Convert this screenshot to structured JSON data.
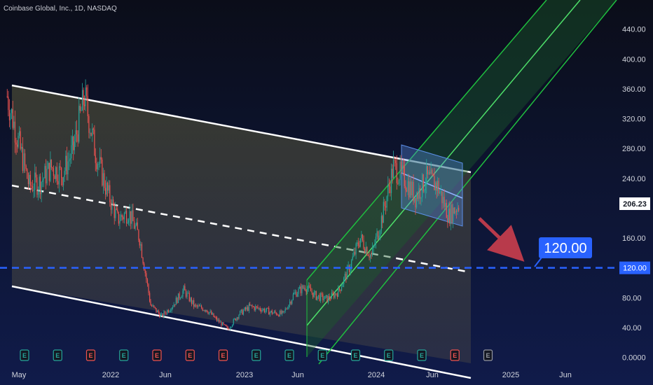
{
  "header": {
    "title": "Coinbase Global, Inc., 1D, NASDAQ"
  },
  "chart_data": {
    "type": "candlestick",
    "title": "Coinbase Global, Inc., 1D, NASDAQ",
    "y_ticks": [
      "440.00",
      "400.00",
      "360.00",
      "320.00",
      "280.00",
      "240.00",
      "160.00",
      "80.00",
      "40.00",
      "0.0000"
    ],
    "x_ticks": [
      "May",
      "2022",
      "Jun",
      "2023",
      "Jun",
      "2024",
      "Jun",
      "2025",
      "Jun"
    ],
    "ylim": [
      0,
      480
    ],
    "last_price": "206.23",
    "target_price": "120.00",
    "target_line_label": "120.00",
    "price_path": [
      {
        "x": "2021-04",
        "y": 350
      },
      {
        "x": "2021-05",
        "y": 290
      },
      {
        "x": "2021-06",
        "y": 230
      },
      {
        "x": "2021-07",
        "y": 235
      },
      {
        "x": "2021-08",
        "y": 255
      },
      {
        "x": "2021-09",
        "y": 245
      },
      {
        "x": "2021-10",
        "y": 280
      },
      {
        "x": "2021-11",
        "y": 350
      },
      {
        "x": "2021-12",
        "y": 275
      },
      {
        "x": "2022-01",
        "y": 225
      },
      {
        "x": "2022-02",
        "y": 185
      },
      {
        "x": "2022-03",
        "y": 195
      },
      {
        "x": "2022-04",
        "y": 160
      },
      {
        "x": "2022-05",
        "y": 70
      },
      {
        "x": "2022-06",
        "y": 55
      },
      {
        "x": "2022-07",
        "y": 70
      },
      {
        "x": "2022-08",
        "y": 90
      },
      {
        "x": "2022-09",
        "y": 68
      },
      {
        "x": "2022-10",
        "y": 65
      },
      {
        "x": "2022-11",
        "y": 50
      },
      {
        "x": "2022-12",
        "y": 38
      },
      {
        "x": "2023-01",
        "y": 58
      },
      {
        "x": "2023-02",
        "y": 68
      },
      {
        "x": "2023-03",
        "y": 65
      },
      {
        "x": "2023-04",
        "y": 60
      },
      {
        "x": "2023-05",
        "y": 58
      },
      {
        "x": "2023-06",
        "y": 85
      },
      {
        "x": "2023-07",
        "y": 95
      },
      {
        "x": "2023-08",
        "y": 82
      },
      {
        "x": "2023-09",
        "y": 78
      },
      {
        "x": "2023-10",
        "y": 88
      },
      {
        "x": "2023-11",
        "y": 120
      },
      {
        "x": "2023-12",
        "y": 160
      },
      {
        "x": "2024-01",
        "y": 135
      },
      {
        "x": "2024-02",
        "y": 190
      },
      {
        "x": "2024-03",
        "y": 255
      },
      {
        "x": "2024-04",
        "y": 240
      },
      {
        "x": "2024-05",
        "y": 215
      },
      {
        "x": "2024-06",
        "y": 240
      },
      {
        "x": "2024-07",
        "y": 230
      },
      {
        "x": "2024-08",
        "y": 190
      },
      {
        "x": "2024-09",
        "y": 206
      }
    ],
    "earnings_markers": [
      {
        "x": "2021-05",
        "type": "E",
        "color": "#26a69a"
      },
      {
        "x": "2021-08",
        "type": "E",
        "color": "#26a69a"
      },
      {
        "x": "2021-11",
        "type": "E",
        "color": "#ef5350"
      },
      {
        "x": "2022-02",
        "type": "E",
        "color": "#26a69a"
      },
      {
        "x": "2022-05",
        "type": "E",
        "color": "#ef5350"
      },
      {
        "x": "2022-08",
        "type": "E",
        "color": "#ef5350"
      },
      {
        "x": "2022-11",
        "type": "E",
        "color": "#ef5350"
      },
      {
        "x": "2023-02",
        "type": "E",
        "color": "#26a69a"
      },
      {
        "x": "2023-05",
        "type": "E",
        "color": "#26a69a"
      },
      {
        "x": "2023-08",
        "type": "E",
        "color": "#26a69a"
      },
      {
        "x": "2023-11",
        "type": "E",
        "color": "#26a69a"
      },
      {
        "x": "2024-02",
        "type": "E",
        "color": "#26a69a"
      },
      {
        "x": "2024-05",
        "type": "E",
        "color": "#26a69a"
      },
      {
        "x": "2024-08",
        "type": "E",
        "color": "#ef5350"
      },
      {
        "x": "2024-11",
        "type": "E",
        "color": "#9598a1"
      }
    ]
  },
  "colors": {
    "up": "#26a69a",
    "down": "#ef5350",
    "accent": "#2962ff",
    "green_channel": "#1fbf3f",
    "blue_channel": "#5b8fe8",
    "arrow": "#b83a4b"
  }
}
